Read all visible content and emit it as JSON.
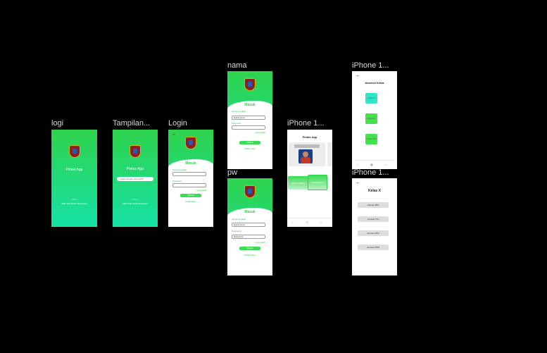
{
  "frames": {
    "logi": {
      "label": "logi",
      "app_title": "Pintas App",
      "from": "From",
      "school": "SMK Plus Pelita Nusantara"
    },
    "tampilan": {
      "label": "Tampilan...",
      "app_title": "Pintas App",
      "input_text": "Lanjut dengan Akun SMK",
      "from": "From",
      "school": "SMK Plus Pelita Nusantara"
    },
    "login": {
      "label": "Login",
      "back_icon": "arrow-left-icon",
      "heading": "Masuk",
      "user_label": "Nama Lengkap",
      "pass_label": "Password",
      "forgot": "Lupa sandi",
      "button": "Masuk",
      "link": "Daftar Akun"
    },
    "nama": {
      "label": "nama",
      "heading": "Masuk",
      "user_label": "Nama Lengkap",
      "user_value": "Ratna Anna",
      "pass_label": "Password",
      "forgot": "Lupa sandi",
      "button": "Masuk",
      "link": "Daftar Akun"
    },
    "pw": {
      "label": "pw",
      "heading": "Masuk",
      "user_label": "Nama Lengkap",
      "user_value": "Ratna Anna",
      "pass_label": "Password",
      "pass_value": "Ratna123",
      "forgot": "Lupa sandi",
      "button": "Masuk",
      "link": "Daftar Akun"
    },
    "home": {
      "label": "iPhone 1...",
      "title": "Pintas App",
      "card1": "Absensi Siswa",
      "card2": "Absensi Guru"
    },
    "absensi": {
      "label": "iPhone 1...",
      "back_icon": "arrow-left-icon",
      "title": "Absensi Kelas",
      "buttons": [
        "Kelas X",
        "Kelas XI",
        "Kelas XII"
      ]
    },
    "kelas": {
      "label": "iPhone 1...",
      "back_icon": "arrow-left-icon",
      "title": "Kelas X",
      "buttons": [
        "Jurusan RPL",
        "Jurusan TKJ",
        "Jurusan DKV",
        "Jurusan PPM"
      ]
    }
  },
  "colors": {
    "green": "#2fd24c",
    "teal": "#16e2a6",
    "canvas": "#000000"
  }
}
